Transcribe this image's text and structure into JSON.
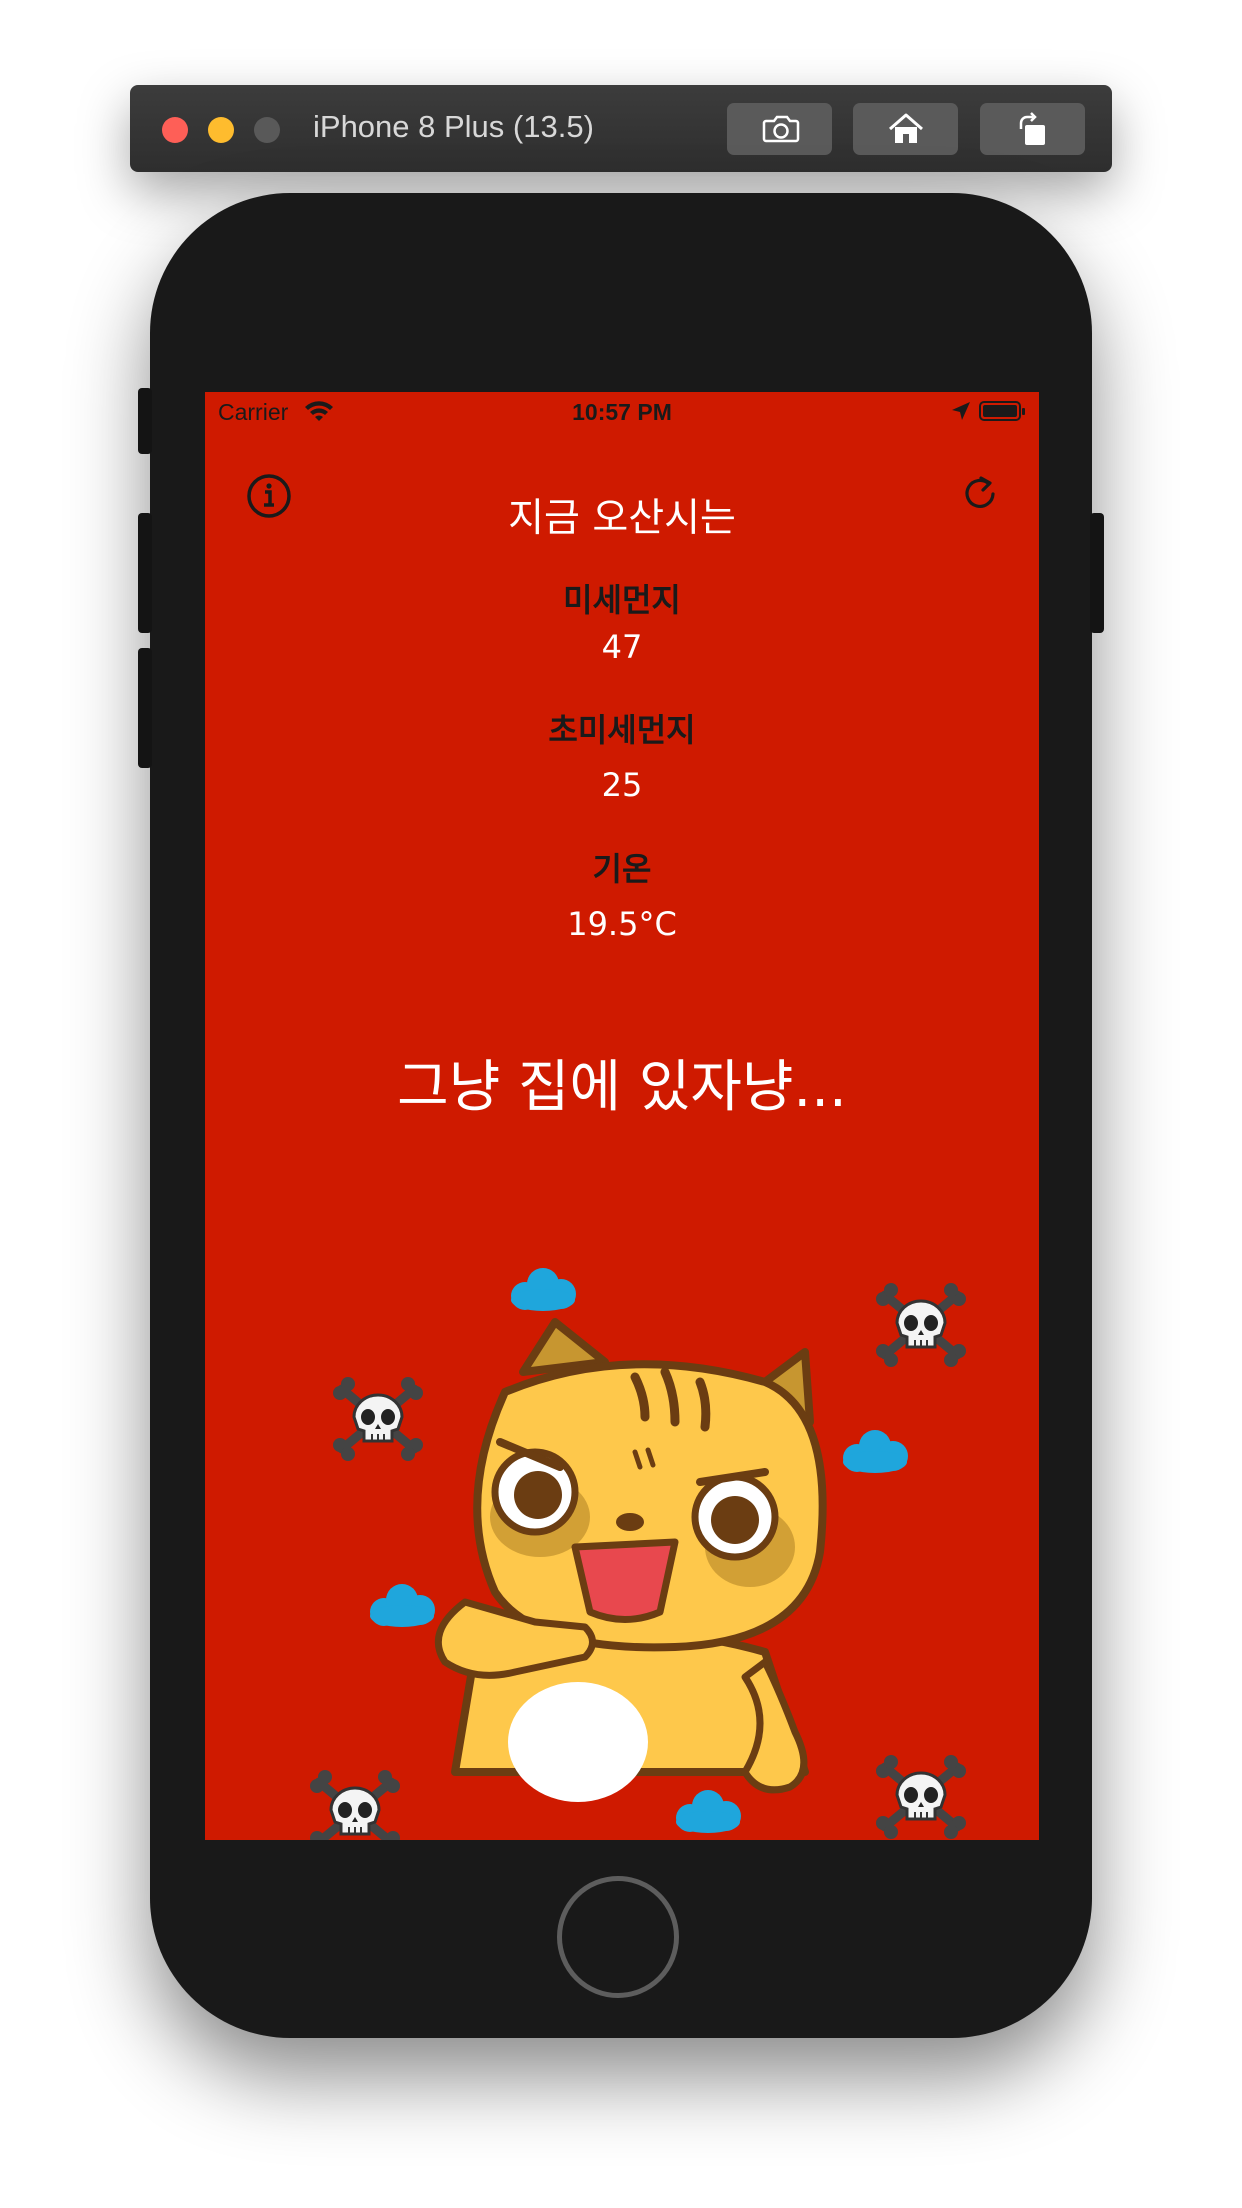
{
  "simulator": {
    "title": "iPhone 8 Plus (13.5)",
    "buttons": [
      "screenshot",
      "home",
      "rotate"
    ]
  },
  "status_bar": {
    "carrier": "Carrier",
    "time": "10:57 PM"
  },
  "header": {
    "title": "지금 오산시는"
  },
  "metrics": [
    {
      "label": "미세먼지",
      "value": "47"
    },
    {
      "label": "초미세먼지",
      "value": "25"
    },
    {
      "label": "기온",
      "value": "19.5°C"
    }
  ],
  "message": "그냥 집에 있자냥...",
  "colors": {
    "screen_background": "#cf1a00",
    "primary_text": "#ffffff",
    "label_text": "#1a1a1a",
    "cat_body": "#fec84b",
    "dust_cloud": "#1fa6dc"
  },
  "icons": {
    "info": "info-circle-icon",
    "refresh": "refresh-icon",
    "decor": [
      "skull-crossbones-icon",
      "dust-cloud-icon"
    ]
  }
}
